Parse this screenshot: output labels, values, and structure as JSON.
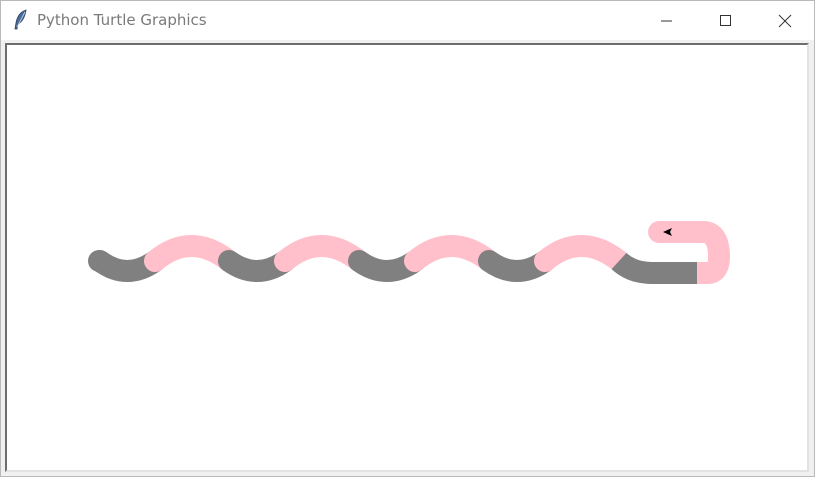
{
  "window": {
    "title": "Python Turtle Graphics",
    "app_icon": "feather-icon",
    "controls": {
      "minimize_icon": "minimize-icon",
      "maximize_icon": "maximize-icon",
      "close_icon": "close-icon"
    }
  },
  "canvas": {
    "background": "#ffffff",
    "drawing": "python-snake",
    "colors": {
      "segment_a": "#808080",
      "segment_b": "#ffc0cb",
      "turtle": "#000000"
    },
    "turtle_icon": "turtle-arrow-icon"
  }
}
